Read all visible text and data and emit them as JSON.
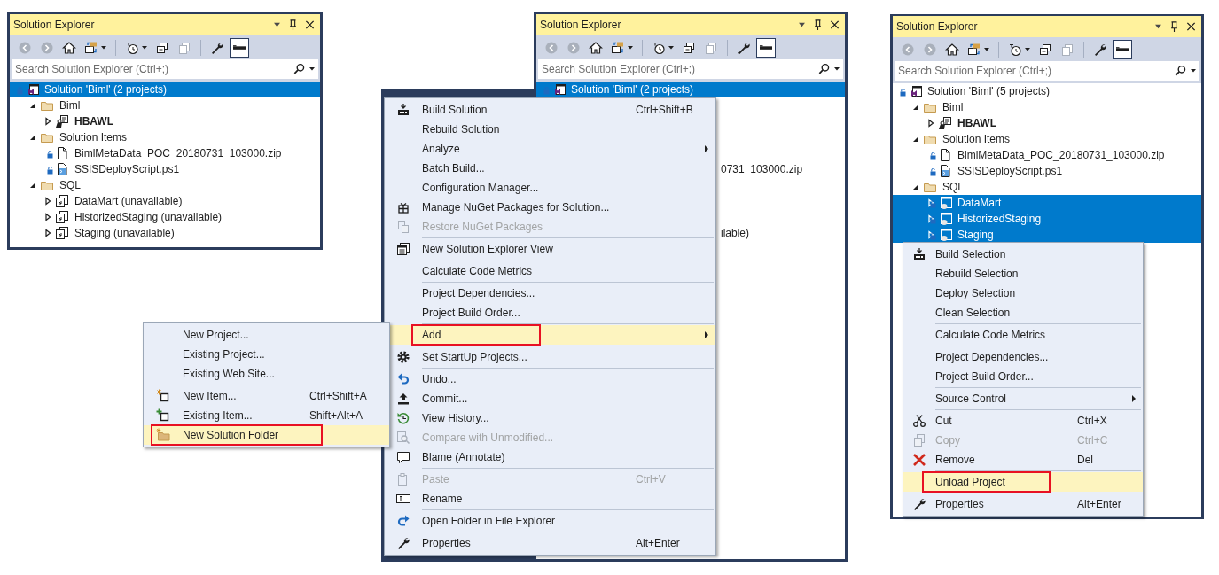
{
  "panels": [
    {
      "title": "Solution Explorer",
      "toolbar": [
        {
          "kind": "back",
          "pressed": false
        },
        {
          "kind": "forward",
          "pressed": false
        },
        {
          "kind": "home",
          "pressed": false
        },
        {
          "kind": "sync",
          "pressed": false,
          "dropdown": true
        },
        {
          "kind": "separator"
        },
        {
          "kind": "clock",
          "pressed": false,
          "dropdown": true
        },
        {
          "kind": "collapse",
          "pressed": false
        },
        {
          "kind": "copies",
          "pressed": false
        },
        {
          "kind": "separator"
        },
        {
          "kind": "wrench",
          "pressed": false
        },
        {
          "kind": "preview",
          "pressed": true
        }
      ],
      "search": {
        "placeholder": "Search Solution Explorer (Ctrl+;)"
      },
      "tree": [
        {
          "kind": "solution",
          "label": "Solution 'Biml' (2 projects)",
          "locked": true,
          "selected": true,
          "children": [
            {
              "kind": "folder",
              "label": "Biml",
              "expanded": true,
              "selected": false,
              "children": [
                {
                  "kind": "project",
                  "label": "HBAWL",
                  "expanded": false,
                  "bold": true,
                  "selected": false
                }
              ]
            },
            {
              "kind": "folder",
              "label": "Solution Items",
              "expanded": true,
              "selected": false,
              "children": [
                {
                  "kind": "file",
                  "label": "BimlMetaData_POC_20180731_103000.zip",
                  "locked": true,
                  "selected": false
                },
                {
                  "kind": "script",
                  "label": "SSISDeployScript.ps1",
                  "locked": true,
                  "selected": false
                }
              ]
            },
            {
              "kind": "folder",
              "label": "SQL",
              "expanded": true,
              "selected": false,
              "children": [
                {
                  "kind": "unavailable",
                  "label": "DataMart (unavailable)",
                  "expanded": false,
                  "selected": false
                },
                {
                  "kind": "unavailable",
                  "label": "HistorizedStaging (unavailable)",
                  "expanded": false,
                  "selected": false
                },
                {
                  "kind": "unavailable",
                  "label": "Staging (unavailable)",
                  "expanded": false,
                  "selected": false
                }
              ]
            }
          ]
        }
      ]
    },
    {
      "title": "Solution Explorer",
      "toolbar": [
        {
          "kind": "back",
          "pressed": false
        },
        {
          "kind": "forward",
          "pressed": false
        },
        {
          "kind": "home",
          "pressed": false
        },
        {
          "kind": "sync",
          "pressed": false,
          "dropdown": true
        },
        {
          "kind": "separator"
        },
        {
          "kind": "clock",
          "pressed": false,
          "dropdown": true
        },
        {
          "kind": "collapse",
          "pressed": false
        },
        {
          "kind": "copies",
          "pressed": false
        },
        {
          "kind": "separator"
        },
        {
          "kind": "wrench",
          "pressed": false
        },
        {
          "kind": "preview",
          "pressed": true
        }
      ],
      "search": {
        "placeholder": "Search Solution Explorer (Ctrl+;)"
      },
      "tree": [
        {
          "kind": "solution",
          "label": "Solution 'Biml' (2 projects)",
          "locked": true,
          "selected": true
        },
        {
          "kind": "covered"
        },
        {
          "kind": "covered"
        },
        {
          "kind": "covered"
        },
        {
          "kind": "covered"
        },
        {
          "kind": "fragment",
          "label": "0731_103000.zip"
        },
        {
          "kind": "covered"
        },
        {
          "kind": "covered"
        },
        {
          "kind": "covered"
        },
        {
          "kind": "fragment",
          "label": "ilable)"
        }
      ],
      "context_menu": {
        "items": [
          {
            "kind": "build",
            "label": "Build Solution",
            "shortcut": "Ctrl+Shift+B",
            "disabled": false,
            "highlighted": false
          },
          {
            "kind": "plain",
            "label": "Rebuild Solution",
            "disabled": false,
            "highlighted": false
          },
          {
            "kind": "plain",
            "label": "Analyze",
            "submenu": true,
            "disabled": false,
            "highlighted": false
          },
          {
            "kind": "plain",
            "label": "Batch Build...",
            "disabled": false,
            "highlighted": false
          },
          {
            "kind": "plain",
            "label": "Configuration Manager...",
            "disabled": false,
            "highlighted": false
          },
          {
            "kind": "gift",
            "label": "Manage NuGet Packages for Solution...",
            "disabled": false,
            "highlighted": false
          },
          {
            "kind": "restore",
            "label": "Restore NuGet Packages",
            "disabled": true,
            "highlighted": false
          },
          {
            "kind": "separator"
          },
          {
            "kind": "windows",
            "label": "New Solution Explorer View",
            "disabled": false,
            "highlighted": false
          },
          {
            "kind": "separator"
          },
          {
            "kind": "plain",
            "label": "Calculate Code Metrics",
            "disabled": false,
            "highlighted": false
          },
          {
            "kind": "separator"
          },
          {
            "kind": "plain",
            "label": "Project Dependencies...",
            "disabled": false,
            "highlighted": false
          },
          {
            "kind": "plain",
            "label": "Project Build Order...",
            "disabled": false,
            "highlighted": false
          },
          {
            "kind": "separator"
          },
          {
            "kind": "plain",
            "label": "Add",
            "submenu": true,
            "disabled": false,
            "highlighted": true,
            "outlined": true,
            "submenu_items": [
              {
                "kind": "plain",
                "label": "New Project...",
                "disabled": false,
                "highlighted": false
              },
              {
                "kind": "plain",
                "label": "Existing Project...",
                "disabled": false,
                "highlighted": false
              },
              {
                "kind": "plain",
                "label": "Existing Web Site...",
                "disabled": false,
                "highlighted": false
              },
              {
                "kind": "separator"
              },
              {
                "kind": "newitem",
                "label": "New Item...",
                "shortcut": "Ctrl+Shift+A",
                "disabled": false,
                "highlighted": false
              },
              {
                "kind": "additem",
                "label": "Existing Item...",
                "shortcut": "Shift+Alt+A",
                "disabled": false,
                "highlighted": false
              },
              {
                "kind": "newfolder",
                "label": "New Solution Folder",
                "disabled": false,
                "highlighted": true,
                "outlined": true
              }
            ]
          },
          {
            "kind": "separator"
          },
          {
            "kind": "gear",
            "label": "Set StartUp Projects...",
            "disabled": false,
            "highlighted": false
          },
          {
            "kind": "separator"
          },
          {
            "kind": "undo",
            "label": "Undo...",
            "disabled": false,
            "highlighted": false
          },
          {
            "kind": "upload",
            "label": "Commit...",
            "disabled": false,
            "highlighted": false
          },
          {
            "kind": "history",
            "label": "View History...",
            "disabled": false,
            "highlighted": false
          },
          {
            "kind": "compare",
            "label": "Compare with Unmodified...",
            "disabled": true,
            "highlighted": false
          },
          {
            "kind": "comment",
            "label": "Blame (Annotate)",
            "disabled": false,
            "highlighted": false
          },
          {
            "kind": "separator"
          },
          {
            "kind": "paste",
            "label": "Paste",
            "shortcut": "Ctrl+V",
            "disabled": true,
            "highlighted": false
          },
          {
            "kind": "rename",
            "label": "Rename",
            "disabled": false,
            "highlighted": false
          },
          {
            "kind": "separator"
          },
          {
            "kind": "redo",
            "label": "Open Folder in File Explorer",
            "disabled": false,
            "highlighted": false
          },
          {
            "kind": "separator"
          },
          {
            "kind": "wrench",
            "label": "Properties",
            "shortcut": "Alt+Enter",
            "disabled": false,
            "highlighted": false
          }
        ]
      }
    },
    {
      "title": "Solution Explorer",
      "toolbar": [
        {
          "kind": "back",
          "pressed": false
        },
        {
          "kind": "forward",
          "pressed": false
        },
        {
          "kind": "home",
          "pressed": false
        },
        {
          "kind": "sync",
          "pressed": false,
          "dropdown": true
        },
        {
          "kind": "separator"
        },
        {
          "kind": "clock",
          "pressed": false,
          "dropdown": true
        },
        {
          "kind": "collapse",
          "pressed": false
        },
        {
          "kind": "copies",
          "pressed": false
        },
        {
          "kind": "separator"
        },
        {
          "kind": "wrench",
          "pressed": false
        },
        {
          "kind": "preview",
          "pressed": true
        }
      ],
      "search": {
        "placeholder": "Search Solution Explorer (Ctrl+;)"
      },
      "tree": [
        {
          "kind": "solution",
          "label": "Solution 'Biml' (5 projects)",
          "locked": true,
          "selected": false,
          "children": [
            {
              "kind": "folder",
              "label": "Biml",
              "expanded": true,
              "selected": false,
              "children": [
                {
                  "kind": "project",
                  "label": "HBAWL",
                  "expanded": false,
                  "bold": true,
                  "selected": false
                }
              ]
            },
            {
              "kind": "folder",
              "label": "Solution Items",
              "expanded": true,
              "selected": false,
              "children": [
                {
                  "kind": "file",
                  "label": "BimlMetaData_POC_20180731_103000.zip",
                  "locked": true,
                  "selected": false
                },
                {
                  "kind": "script",
                  "label": "SSISDeployScript.ps1",
                  "locked": true,
                  "selected": false
                }
              ]
            },
            {
              "kind": "folder",
              "label": "SQL",
              "expanded": true,
              "selected": false,
              "children": [
                {
                  "kind": "database",
                  "label": "DataMart",
                  "expanded": false,
                  "locked": true,
                  "selected": true
                },
                {
                  "kind": "database",
                  "label": "HistorizedStaging",
                  "expanded": false,
                  "locked": true,
                  "selected": true
                },
                {
                  "kind": "database",
                  "label": "Staging",
                  "expanded": false,
                  "locked": true,
                  "selected": true
                }
              ]
            }
          ]
        }
      ],
      "context_menu": {
        "items": [
          {
            "kind": "build",
            "label": "Build Selection",
            "disabled": false,
            "highlighted": false
          },
          {
            "kind": "plain",
            "label": "Rebuild Selection",
            "disabled": false,
            "highlighted": false
          },
          {
            "kind": "plain",
            "label": "Deploy Selection",
            "disabled": false,
            "highlighted": false
          },
          {
            "kind": "plain",
            "label": "Clean Selection",
            "disabled": false,
            "highlighted": false
          },
          {
            "kind": "separator"
          },
          {
            "kind": "plain",
            "label": "Calculate Code Metrics",
            "disabled": false,
            "highlighted": false
          },
          {
            "kind": "separator"
          },
          {
            "kind": "plain",
            "label": "Project Dependencies...",
            "disabled": false,
            "highlighted": false
          },
          {
            "kind": "plain",
            "label": "Project Build Order...",
            "disabled": false,
            "highlighted": false
          },
          {
            "kind": "separator"
          },
          {
            "kind": "plain",
            "label": "Source Control",
            "submenu": true,
            "disabled": false,
            "highlighted": false
          },
          {
            "kind": "separator"
          },
          {
            "kind": "scissors",
            "label": "Cut",
            "shortcut": "Ctrl+X",
            "disabled": false,
            "highlighted": false
          },
          {
            "kind": "copy",
            "label": "Copy",
            "shortcut": "Ctrl+C",
            "disabled": true,
            "highlighted": false
          },
          {
            "kind": "remove",
            "label": "Remove",
            "shortcut": "Del",
            "disabled": false,
            "highlighted": false
          },
          {
            "kind": "separator"
          },
          {
            "kind": "plain",
            "label": "Unload Project",
            "disabled": false,
            "highlighted": true,
            "outlined": true
          },
          {
            "kind": "separator"
          },
          {
            "kind": "wrench",
            "label": "Properties",
            "shortcut": "Alt+Enter",
            "disabled": false,
            "highlighted": false
          }
        ]
      }
    }
  ]
}
